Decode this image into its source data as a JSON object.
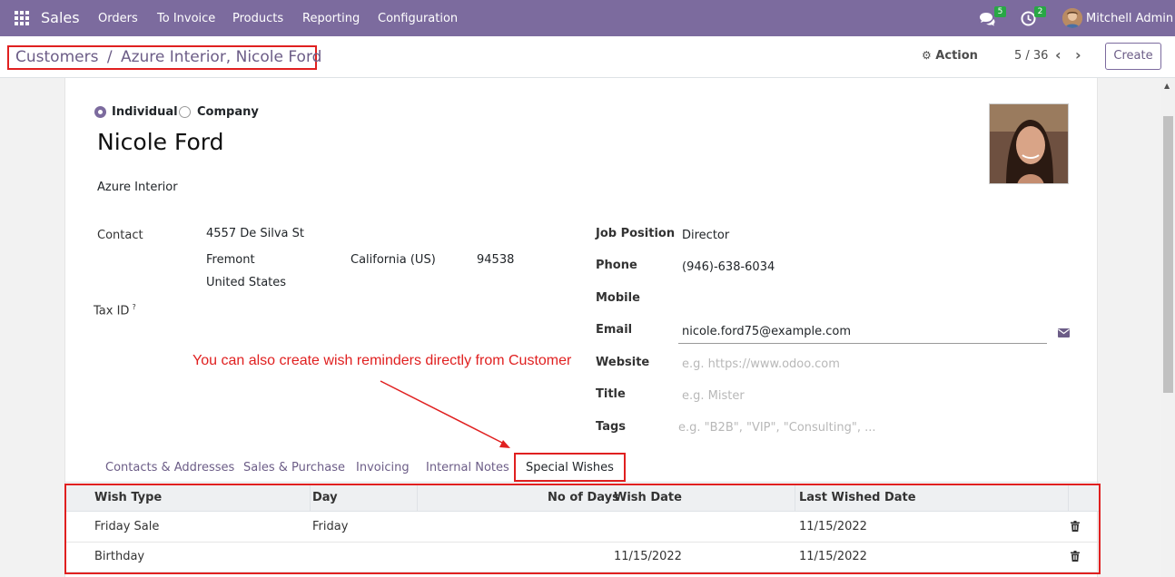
{
  "navbar": {
    "app_name": "Sales",
    "menu": [
      "Orders",
      "To Invoice",
      "Products",
      "Reporting",
      "Configuration"
    ],
    "messages_count": "5",
    "activities_count": "2",
    "user_name": "Mitchell Admin"
  },
  "control_panel": {
    "breadcrumb_parent": "Customers",
    "breadcrumb_separator": "/",
    "breadcrumb_current": "Azure Interior, Nicole Ford",
    "action_label": "Action",
    "pager": "5 / 36",
    "create_label": "Create"
  },
  "form": {
    "type_individual": "Individual",
    "type_company": "Company",
    "name": "Nicole Ford",
    "company": "Azure Interior",
    "contact_label": "Contact",
    "street": "4557 De Silva St",
    "city": "Fremont",
    "state": "California (US)",
    "zip": "94538",
    "country": "United States",
    "tax_id_label": "Tax ID",
    "tax_id_help": "?",
    "job_position_label": "Job Position",
    "job_position": "Director",
    "phone_label": "Phone",
    "phone": "(946)-638-6034",
    "mobile_label": "Mobile",
    "email_label": "Email",
    "email": "nicole.ford75@example.com",
    "website_label": "Website",
    "website_placeholder": "e.g. https://www.odoo.com",
    "title_label": "Title",
    "title_placeholder": "e.g. Mister",
    "tags_label": "Tags",
    "tags_placeholder": "e.g. \"B2B\", \"VIP\", \"Consulting\", ..."
  },
  "annotation": "You can also create wish reminders directly from Customer",
  "tabs": [
    "Contacts & Addresses",
    "Sales & Purchase",
    "Invoicing",
    "Internal Notes",
    "Special Wishes"
  ],
  "active_tab": "Special Wishes",
  "wishes": {
    "columns": [
      "Wish Type",
      "Day",
      "No of Days",
      "Wish Date",
      "Last Wished Date"
    ],
    "rows": [
      {
        "wish_type": "Friday Sale",
        "day": "Friday",
        "no_of_days": "",
        "wish_date": "",
        "last_wished_date": "11/15/2022"
      },
      {
        "wish_type": "Birthday",
        "day": "",
        "no_of_days": "",
        "wish_date": "11/15/2022",
        "last_wished_date": "11/15/2022"
      }
    ]
  },
  "colors": {
    "navbar": "#7c6b9e",
    "link": "#6c5d87",
    "highlight": "#e02020",
    "badge": "#28a745"
  }
}
